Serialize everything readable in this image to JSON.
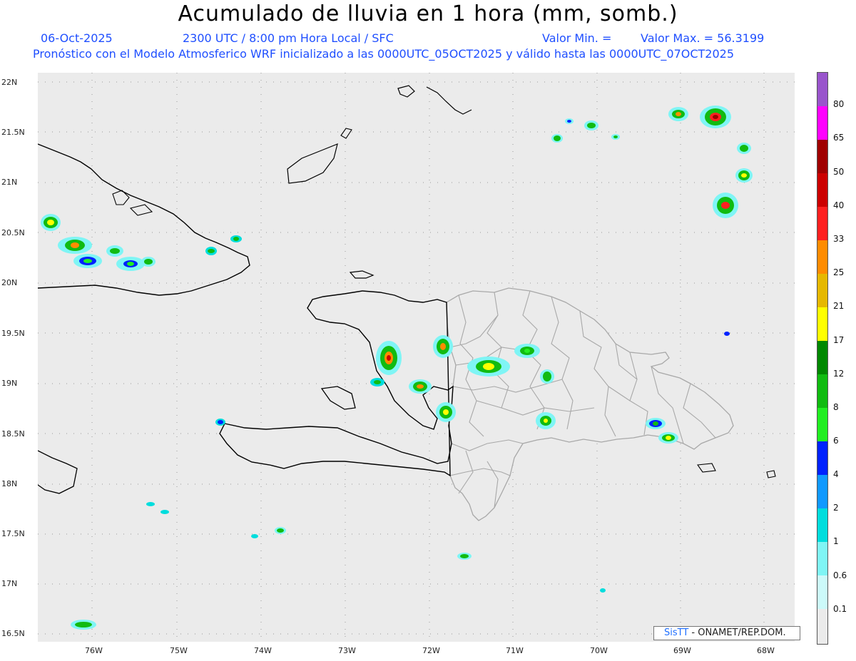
{
  "header": {
    "title": "Acumulado de lluvia en 1 hora (mm, somb.)",
    "date": "06-Oct-2025",
    "time_info": "2300 UTC / 8:00 pm Hora Local / SFC",
    "valor_min": "Valor Min. =",
    "valor_max": "Valor Max. = 56.3199",
    "model_info": "Pronóstico con el Modelo Atmosferico WRF inicializado a las 0000UTC_05OCT2025 y válido hasta las  0000UTC_07OCT2025"
  },
  "map": {
    "background": "#ebebeb",
    "lat_labels": [
      "22N",
      "21.5N",
      "21N",
      "20.5N",
      "20N",
      "19.5N",
      "19N",
      "18.5N",
      "18N",
      "17.5N",
      "17N",
      "16.5N"
    ],
    "lon_labels": [
      "76W",
      "75W",
      "74W",
      "73W",
      "72W",
      "71W",
      "70W",
      "69W",
      "68W"
    ]
  },
  "colorbar": {
    "labels": [
      "80",
      "65",
      "50",
      "40",
      "33",
      "25",
      "21",
      "17",
      "12",
      "8",
      "6",
      "4",
      "2",
      "1",
      "0.6",
      "0.1"
    ],
    "colors": [
      "#9955cc",
      "#ff00ff",
      "#a00000",
      "#cc0000",
      "#ff2020",
      "#ff8c00",
      "#e6b800",
      "#ffff00",
      "#008800",
      "#11bb11",
      "#22ee22",
      "#0022ff",
      "#1199ff",
      "#00dddd",
      "#7ff5f5",
      "#ccfafa",
      "#ebebeb"
    ]
  },
  "credit": {
    "brand": "SisTT",
    "text": " - ONAMET/REP.DOM."
  }
}
